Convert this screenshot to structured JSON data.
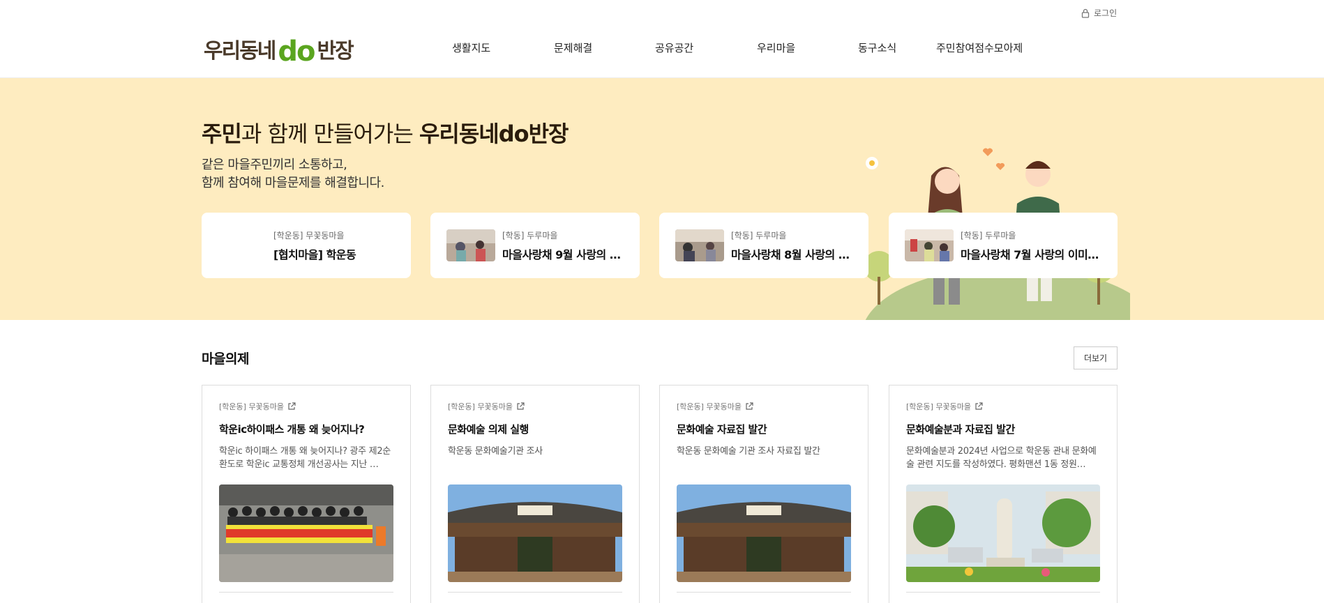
{
  "header": {
    "login_label": "로그인",
    "logo_pre": "우리동네",
    "logo_do": "do",
    "logo_post": "반장",
    "nav": [
      "생활지도",
      "문제해결",
      "공유공간",
      "우리마을",
      "동구소식",
      "주민참여점수모아제"
    ]
  },
  "hero": {
    "title_bold1": "주민",
    "title_mid": "과 함께 만들어가는 ",
    "title_bold2": "우리동네do반장",
    "sub_line1": "같은 마을주민끼리 소통하고,",
    "sub_line2": "함께 참여해 마을문제를 해결합니다.",
    "cards": [
      {
        "meta": "[학운동] 무꽃동마을",
        "title": "[협치마을] 학운동"
      },
      {
        "meta": "[학동] 두루마을",
        "title": "마을사랑채 9월 사랑의 …"
      },
      {
        "meta": "[학동] 두루마을",
        "title": "마을사랑채 8월 사랑의 …"
      },
      {
        "meta": "[학동] 두루마을",
        "title": "마을사랑채 7월 사랑의 이미용…"
      }
    ]
  },
  "agenda": {
    "section_title": "마을의제",
    "more_label": "더보기",
    "cards": [
      {
        "meta": "[학운동] 무꽃동마을",
        "title": "학운ic하이패스 개통 왜 늦어지나?",
        "desc": "학운ic 하이패스 개통 왜 늦어지나? 광주 제2순환도로 학운ic 교통정체 개선공사는 지난 …"
      },
      {
        "meta": "[학운동] 무꽃동마을",
        "title": "문화예술 의제 실행",
        "desc": "학운동 문화예술기관 조사"
      },
      {
        "meta": "[학운동] 무꽃동마을",
        "title": "문화예술 자료집 발간",
        "desc": "학운동 문화예술 기관 조사 자료집 발간"
      },
      {
        "meta": "[학운동] 무꽃동마을",
        "title": "문화예술분과 자료집 발간",
        "desc": "문화예술분과 2024년 사업으로 학운동 관내 문화예술 관련 지도를 작성하였다. 평화맨션 1동 정원…"
      }
    ]
  },
  "colors": {
    "hero_bg": "#feecc0",
    "logo_green": "#5aa51f",
    "logo_brown": "#4a3a2a"
  }
}
